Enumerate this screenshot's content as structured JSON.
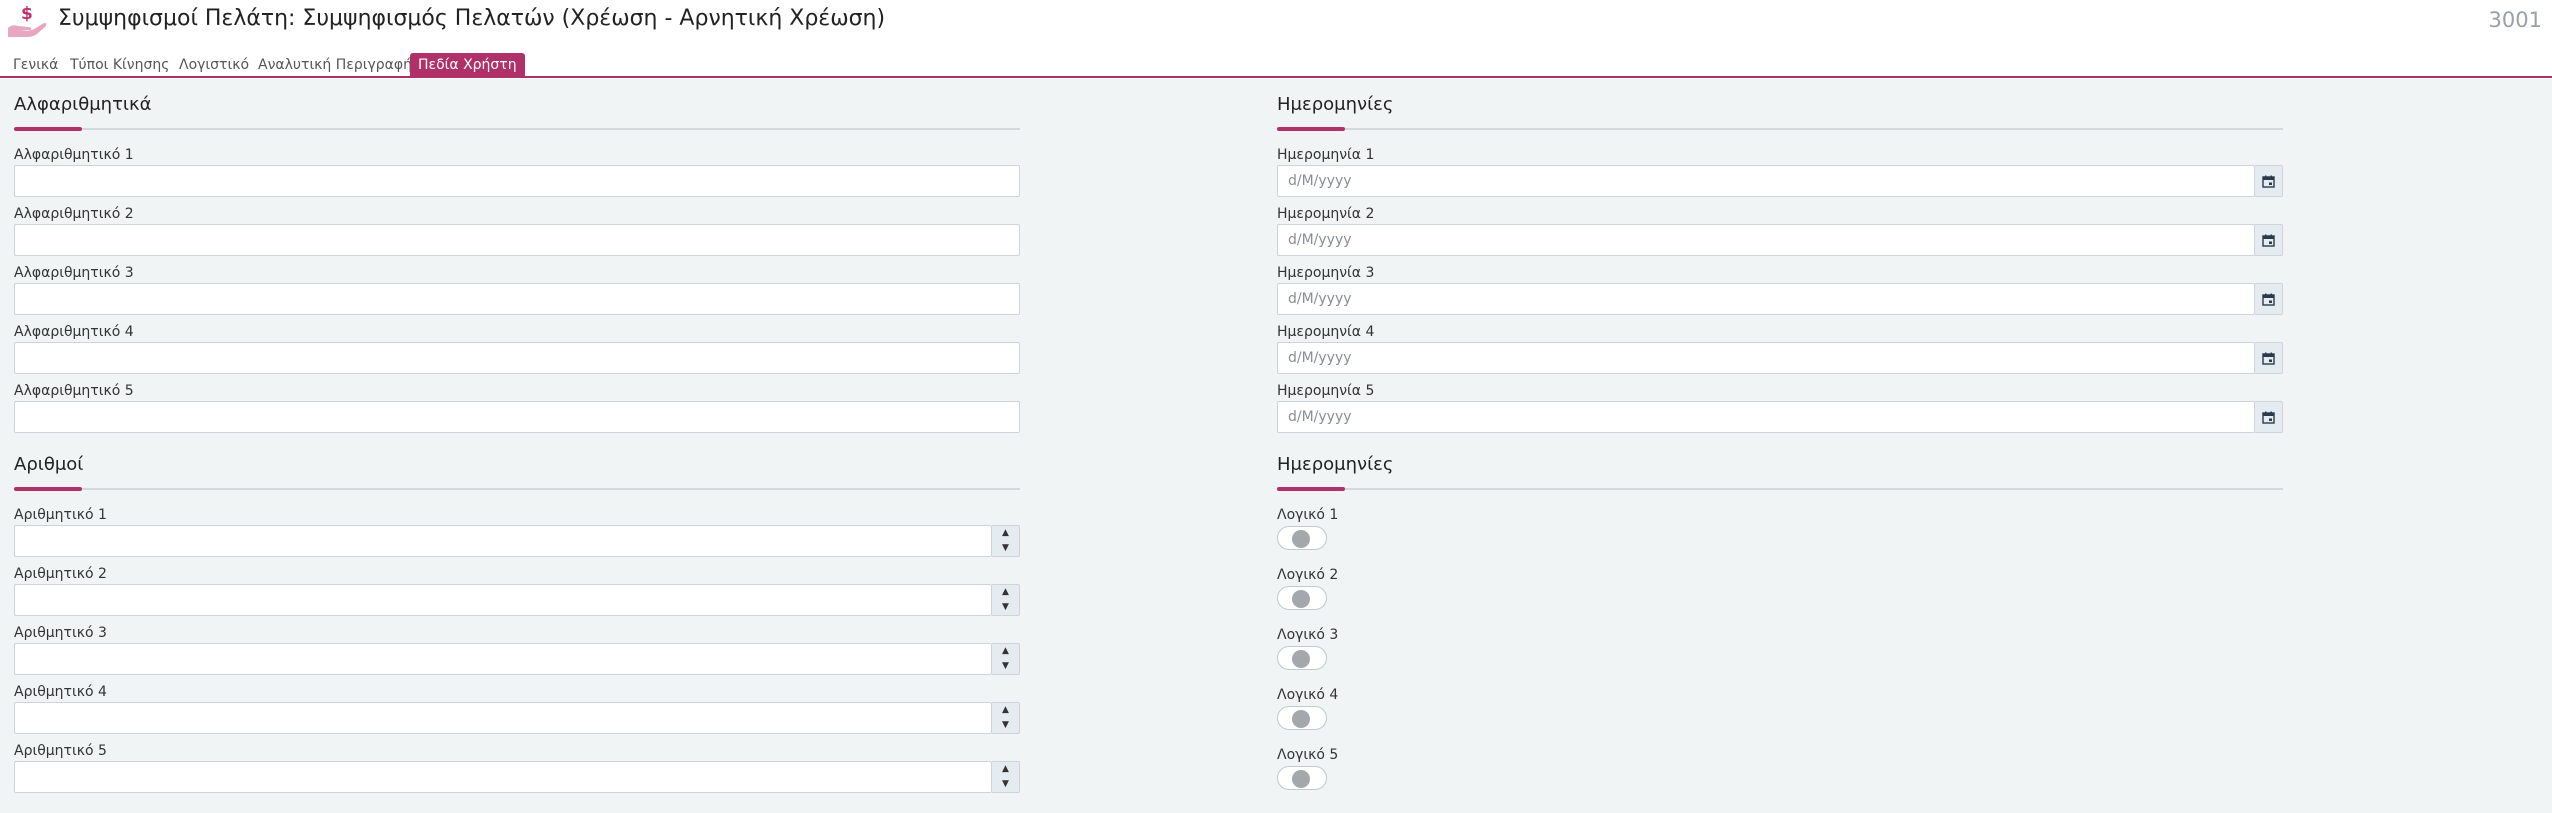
{
  "header": {
    "title": "Συμψηφισμοί Πελάτη: Συμψηφισμός Πελατών (Χρέωση - Αρνητική Χρέωση)",
    "record_id": "3001",
    "icon": "hand-dollar-icon"
  },
  "tabs": [
    {
      "label": "Γενικά",
      "active": false
    },
    {
      "label": "Τύποι Κίνησης",
      "active": false
    },
    {
      "label": "Λογιστικό",
      "active": false
    },
    {
      "label": "Αναλυτική Περιγραφή",
      "active": false
    },
    {
      "label": "Πεδία Χρήστη",
      "active": true
    }
  ],
  "sections": {
    "alphanumeric": {
      "title": "Αλφαριθμητικά",
      "fields": [
        {
          "label": "Αλφαριθμητικό 1",
          "value": ""
        },
        {
          "label": "Αλφαριθμητικό 2",
          "value": ""
        },
        {
          "label": "Αλφαριθμητικό 3",
          "value": ""
        },
        {
          "label": "Αλφαριθμητικό 4",
          "value": ""
        },
        {
          "label": "Αλφαριθμητικό 5",
          "value": ""
        }
      ]
    },
    "dates": {
      "title": "Ημερομηνίες",
      "fields": [
        {
          "label": "Ημερομηνία 1",
          "placeholder": "d/M/yyyy",
          "value": ""
        },
        {
          "label": "Ημερομηνία 2",
          "placeholder": "d/M/yyyy",
          "value": ""
        },
        {
          "label": "Ημερομηνία 3",
          "placeholder": "d/M/yyyy",
          "value": ""
        },
        {
          "label": "Ημερομηνία 4",
          "placeholder": "d/M/yyyy",
          "value": ""
        },
        {
          "label": "Ημερομηνία 5",
          "placeholder": "d/M/yyyy",
          "value": ""
        }
      ]
    },
    "numbers": {
      "title": "Αριθμοί",
      "fields": [
        {
          "label": "Αριθμητικό 1",
          "value": ""
        },
        {
          "label": "Αριθμητικό 2",
          "value": ""
        },
        {
          "label": "Αριθμητικό 3",
          "value": ""
        },
        {
          "label": "Αριθμητικό 4",
          "value": ""
        },
        {
          "label": "Αριθμητικό 5",
          "value": ""
        }
      ]
    },
    "booleans": {
      "title": "Ημερομηνίες",
      "fields": [
        {
          "label": "Λογικό 1",
          "checked": false
        },
        {
          "label": "Λογικό 2",
          "checked": false
        },
        {
          "label": "Λογικό 3",
          "checked": false
        },
        {
          "label": "Λογικό 4",
          "checked": false
        },
        {
          "label": "Λογικό 5",
          "checked": false
        }
      ]
    }
  },
  "spin": {
    "up": "▲",
    "down": "▼"
  },
  "colors": {
    "accent": "#b0306a",
    "background": "#f1f4f5",
    "toggle_knob": "#a3a8ac"
  }
}
